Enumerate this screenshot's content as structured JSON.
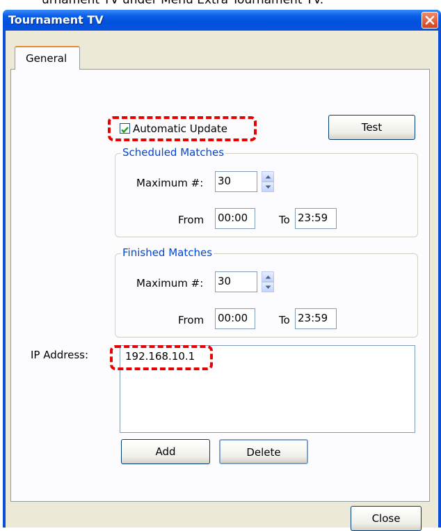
{
  "caption_text": "urnament TV under Menu Extra Tournament TV.",
  "window": {
    "title": "Tournament TV"
  },
  "tabs": [
    {
      "label": "General"
    }
  ],
  "auto_update": {
    "label": "Automatic Update",
    "checked": true
  },
  "test_button": {
    "label": "Test"
  },
  "scheduled": {
    "title": "Scheduled Matches",
    "max_label": "Maximum #:",
    "max_value": "30",
    "from_label": "From",
    "from_value": "00:00",
    "to_label": "To",
    "to_value": "23:59"
  },
  "finished": {
    "title": "Finished Matches",
    "max_label": "Maximum #:",
    "max_value": "30",
    "from_label": "From",
    "from_value": "00:00",
    "to_label": "To",
    "to_value": "23:59"
  },
  "ip": {
    "label": "IP Address:",
    "items": [
      "192.168.10.1"
    ]
  },
  "buttons": {
    "add": "Add",
    "delete": "Delete",
    "close": "Close"
  },
  "colors": {
    "titlebar": "#0a5ee8",
    "group_title": "#0046d5",
    "highlight": "#e60000",
    "face": "#ece9d8"
  },
  "icons": {
    "close": "close-x-icon",
    "check": "checkmark-icon",
    "spin_up": "spin-up-icon",
    "spin_down": "spin-down-icon"
  }
}
